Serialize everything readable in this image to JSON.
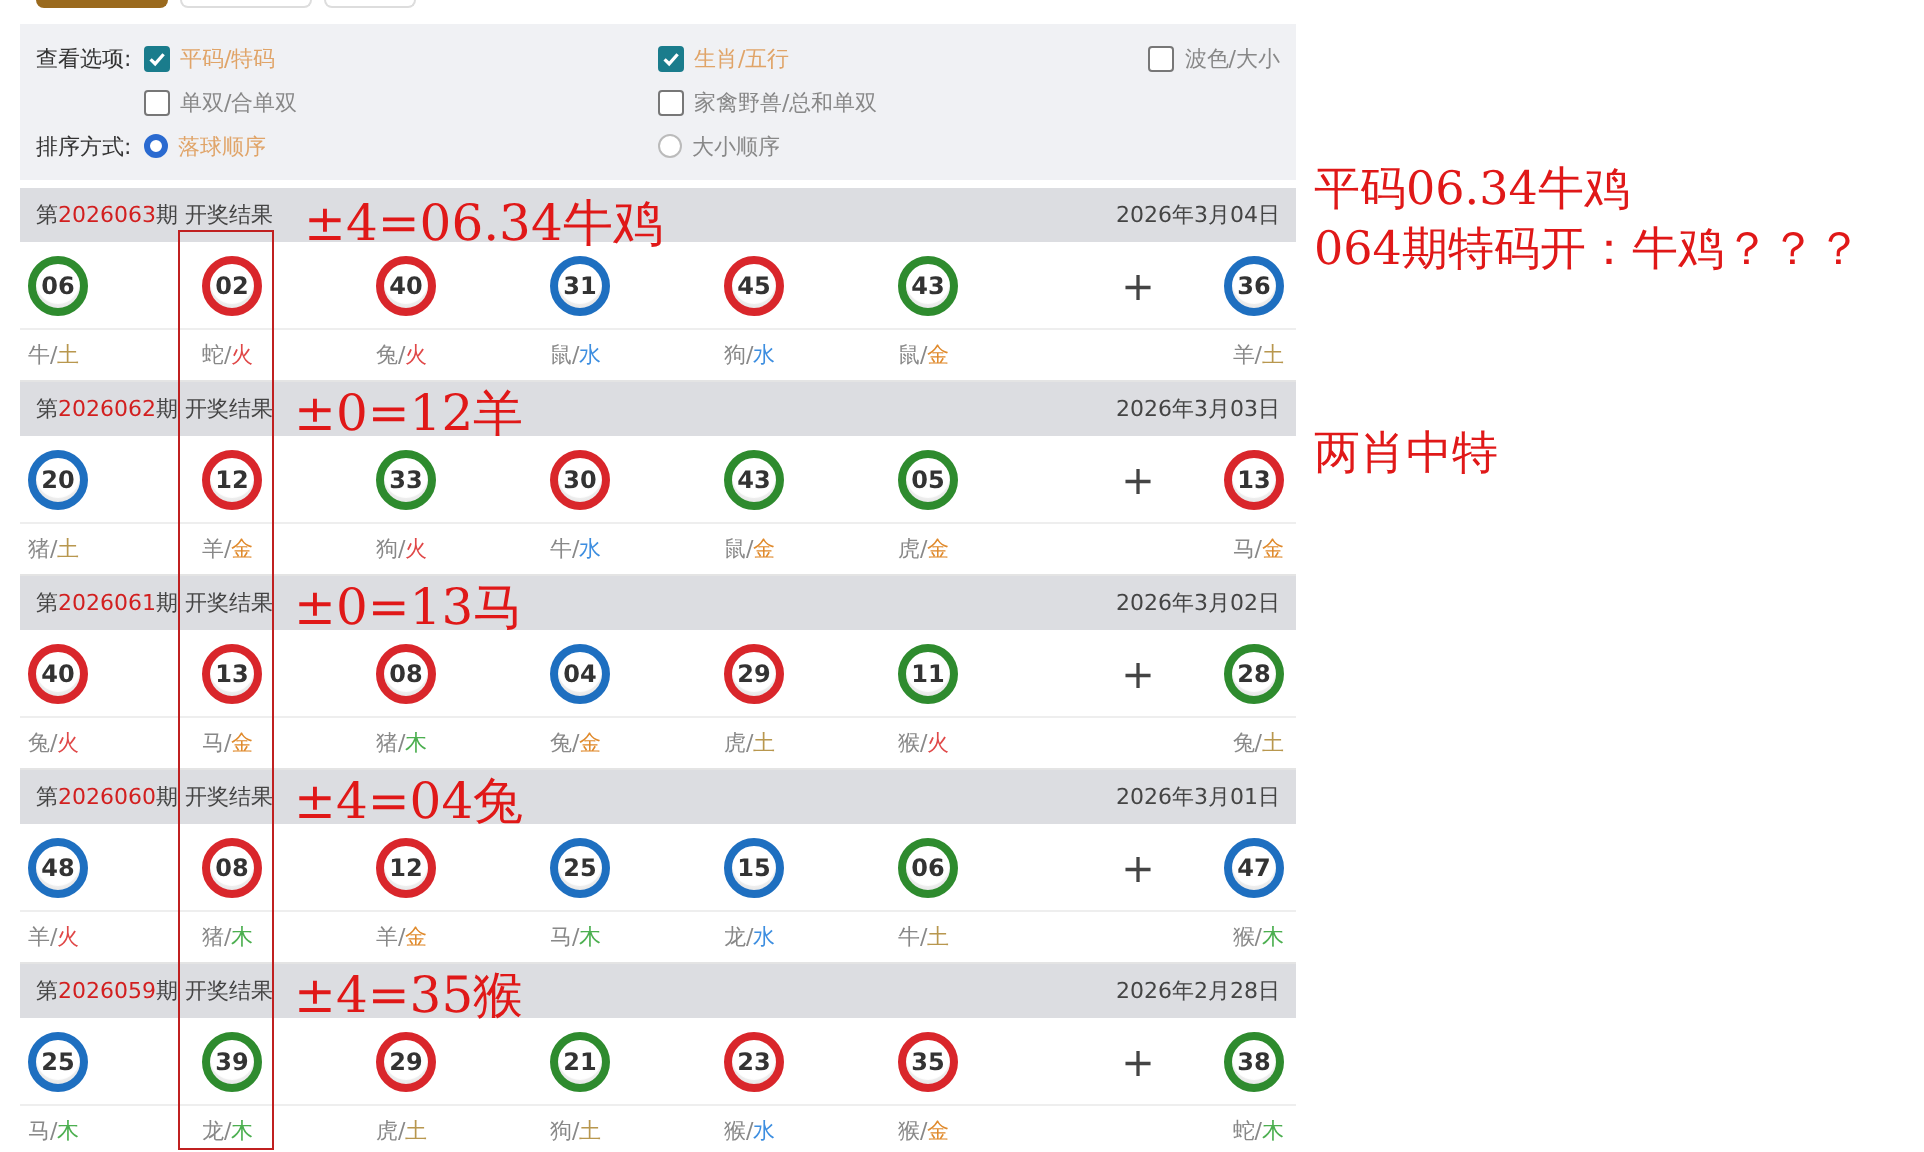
{
  "top_buttons": [
    {
      "selected": true
    },
    {
      "selected": false
    },
    {
      "selected": false
    }
  ],
  "options": {
    "label": "查看选项:",
    "items": [
      {
        "label": "平码/特码",
        "checked": true
      },
      {
        "label": "生肖/五行",
        "checked": true
      },
      {
        "label": "波色/大小",
        "checked": false
      },
      {
        "label": "单双/合单双",
        "checked": false
      },
      {
        "label": "家禽野兽/总和单双",
        "checked": false
      }
    ]
  },
  "sort": {
    "label": "排序方式:",
    "options": [
      {
        "label": "落球顺序",
        "selected": true
      },
      {
        "label": "大小顺序",
        "selected": false
      }
    ]
  },
  "draws": [
    {
      "title_prefix": "第",
      "period": "2026063",
      "title_suffix": "期 开奖结果",
      "date": "2026年3月04日",
      "annotation": "±4=06.34牛鸡",
      "plus": "+",
      "balls": [
        {
          "number": "06",
          "color": "#2e8b2e",
          "zodiac": "牛/",
          "element": {
            "label": "土",
            "color": "#b8974e"
          }
        },
        {
          "number": "02",
          "color": "#d9262b",
          "zodiac": "蛇/",
          "element": {
            "label": "火",
            "color": "#e04848"
          }
        },
        {
          "number": "40",
          "color": "#d9262b",
          "zodiac": "兔/",
          "element": {
            "label": "火",
            "color": "#e04848"
          }
        },
        {
          "number": "31",
          "color": "#1e6fc0",
          "zodiac": "鼠/",
          "element": {
            "label": "水",
            "color": "#3d8ee0"
          }
        },
        {
          "number": "45",
          "color": "#d9262b",
          "zodiac": "狗/",
          "element": {
            "label": "水",
            "color": "#3d8ee0"
          }
        },
        {
          "number": "43",
          "color": "#2e8b2e",
          "zodiac": "鼠/",
          "element": {
            "label": "金",
            "color": "#e08a2c"
          }
        },
        {
          "number": "36",
          "color": "#1e6fc0",
          "zodiac": "羊/",
          "element": {
            "label": "土",
            "color": "#b8974e"
          }
        }
      ]
    },
    {
      "title_prefix": "第",
      "period": "2026062",
      "title_suffix": "期 开奖结果",
      "date": "2026年3月03日",
      "annotation": "±0=12羊",
      "plus": "+",
      "balls": [
        {
          "number": "20",
          "color": "#1e6fc0",
          "zodiac": "猪/",
          "element": {
            "label": "土",
            "color": "#b8974e"
          }
        },
        {
          "number": "12",
          "color": "#d9262b",
          "zodiac": "羊/",
          "element": {
            "label": "金",
            "color": "#e08a2c"
          }
        },
        {
          "number": "33",
          "color": "#2e8b2e",
          "zodiac": "狗/",
          "element": {
            "label": "火",
            "color": "#e04848"
          }
        },
        {
          "number": "30",
          "color": "#d9262b",
          "zodiac": "牛/",
          "element": {
            "label": "水",
            "color": "#3d8ee0"
          }
        },
        {
          "number": "43",
          "color": "#2e8b2e",
          "zodiac": "鼠/",
          "element": {
            "label": "金",
            "color": "#e08a2c"
          }
        },
        {
          "number": "05",
          "color": "#2e8b2e",
          "zodiac": "虎/",
          "element": {
            "label": "金",
            "color": "#e08a2c"
          }
        },
        {
          "number": "13",
          "color": "#d9262b",
          "zodiac": "马/",
          "element": {
            "label": "金",
            "color": "#e08a2c"
          }
        }
      ]
    },
    {
      "title_prefix": "第",
      "period": "2026061",
      "title_suffix": "期 开奖结果",
      "date": "2026年3月02日",
      "annotation": "±0=13马",
      "plus": "+",
      "balls": [
        {
          "number": "40",
          "color": "#d9262b",
          "zodiac": "兔/",
          "element": {
            "label": "火",
            "color": "#e04848"
          }
        },
        {
          "number": "13",
          "color": "#d9262b",
          "zodiac": "马/",
          "element": {
            "label": "金",
            "color": "#e08a2c"
          }
        },
        {
          "number": "08",
          "color": "#d9262b",
          "zodiac": "猪/",
          "element": {
            "label": "木",
            "color": "#4caf50"
          }
        },
        {
          "number": "04",
          "color": "#1e6fc0",
          "zodiac": "兔/",
          "element": {
            "label": "金",
            "color": "#e08a2c"
          }
        },
        {
          "number": "29",
          "color": "#d9262b",
          "zodiac": "虎/",
          "element": {
            "label": "土",
            "color": "#b8974e"
          }
        },
        {
          "number": "11",
          "color": "#2e8b2e",
          "zodiac": "猴/",
          "element": {
            "label": "火",
            "color": "#e04848"
          }
        },
        {
          "number": "28",
          "color": "#2e8b2e",
          "zodiac": "兔/",
          "element": {
            "label": "土",
            "color": "#b8974e"
          }
        }
      ]
    },
    {
      "title_prefix": "第",
      "period": "2026060",
      "title_suffix": "期 开奖结果",
      "date": "2026年3月01日",
      "annotation": "±4=04兔",
      "plus": "+",
      "balls": [
        {
          "number": "48",
          "color": "#1e6fc0",
          "zodiac": "羊/",
          "element": {
            "label": "火",
            "color": "#e04848"
          }
        },
        {
          "number": "08",
          "color": "#d9262b",
          "zodiac": "猪/",
          "element": {
            "label": "木",
            "color": "#4caf50"
          }
        },
        {
          "number": "12",
          "color": "#d9262b",
          "zodiac": "羊/",
          "element": {
            "label": "金",
            "color": "#e08a2c"
          }
        },
        {
          "number": "25",
          "color": "#1e6fc0",
          "zodiac": "马/",
          "element": {
            "label": "木",
            "color": "#4caf50"
          }
        },
        {
          "number": "15",
          "color": "#1e6fc0",
          "zodiac": "龙/",
          "element": {
            "label": "水",
            "color": "#3d8ee0"
          }
        },
        {
          "number": "06",
          "color": "#2e8b2e",
          "zodiac": "牛/",
          "element": {
            "label": "土",
            "color": "#b8974e"
          }
        },
        {
          "number": "47",
          "color": "#1e6fc0",
          "zodiac": "猴/",
          "element": {
            "label": "木",
            "color": "#4caf50"
          }
        }
      ]
    },
    {
      "title_prefix": "第",
      "period": "2026059",
      "title_suffix": "期 开奖结果",
      "date": "2026年2月28日",
      "annotation": "±4=35猴",
      "plus": "+",
      "balls": [
        {
          "number": "25",
          "color": "#1e6fc0",
          "zodiac": "马/",
          "element": {
            "label": "木",
            "color": "#4caf50"
          }
        },
        {
          "number": "39",
          "color": "#2e8b2e",
          "zodiac": "龙/",
          "element": {
            "label": "木",
            "color": "#4caf50"
          }
        },
        {
          "number": "29",
          "color": "#d9262b",
          "zodiac": "虎/",
          "element": {
            "label": "土",
            "color": "#b8974e"
          }
        },
        {
          "number": "21",
          "color": "#2e8b2e",
          "zodiac": "狗/",
          "element": {
            "label": "土",
            "color": "#b8974e"
          }
        },
        {
          "number": "23",
          "color": "#d9262b",
          "zodiac": "猴/",
          "element": {
            "label": "水",
            "color": "#3d8ee0"
          }
        },
        {
          "number": "35",
          "color": "#d9262b",
          "zodiac": "猴/",
          "element": {
            "label": "金",
            "color": "#e08a2c"
          }
        },
        {
          "number": "38",
          "color": "#2e8b2e",
          "zodiac": "蛇/",
          "element": {
            "label": "木",
            "color": "#4caf50"
          }
        }
      ]
    }
  ],
  "notes": [
    {
      "lines": [
        "平码06.34牛鸡",
        "064期特码开：牛鸡？？？"
      ]
    },
    {
      "lines": [
        "两肖中特"
      ]
    }
  ]
}
